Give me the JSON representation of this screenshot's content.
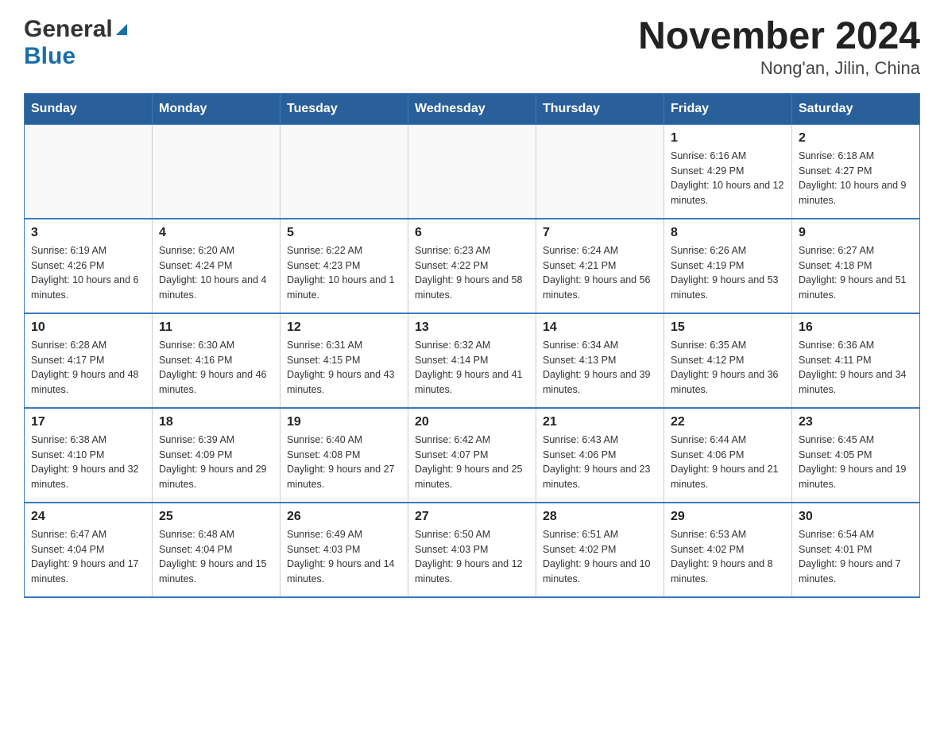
{
  "logo": {
    "general_text": "General",
    "blue_text": "Blue"
  },
  "title": "November 2024",
  "subtitle": "Nong'an, Jilin, China",
  "days_header": [
    "Sunday",
    "Monday",
    "Tuesday",
    "Wednesday",
    "Thursday",
    "Friday",
    "Saturday"
  ],
  "weeks": [
    {
      "days": [
        {
          "num": "",
          "info": ""
        },
        {
          "num": "",
          "info": ""
        },
        {
          "num": "",
          "info": ""
        },
        {
          "num": "",
          "info": ""
        },
        {
          "num": "",
          "info": ""
        },
        {
          "num": "1",
          "info": "Sunrise: 6:16 AM\nSunset: 4:29 PM\nDaylight: 10 hours and 12 minutes."
        },
        {
          "num": "2",
          "info": "Sunrise: 6:18 AM\nSunset: 4:27 PM\nDaylight: 10 hours and 9 minutes."
        }
      ]
    },
    {
      "days": [
        {
          "num": "3",
          "info": "Sunrise: 6:19 AM\nSunset: 4:26 PM\nDaylight: 10 hours and 6 minutes."
        },
        {
          "num": "4",
          "info": "Sunrise: 6:20 AM\nSunset: 4:24 PM\nDaylight: 10 hours and 4 minutes."
        },
        {
          "num": "5",
          "info": "Sunrise: 6:22 AM\nSunset: 4:23 PM\nDaylight: 10 hours and 1 minute."
        },
        {
          "num": "6",
          "info": "Sunrise: 6:23 AM\nSunset: 4:22 PM\nDaylight: 9 hours and 58 minutes."
        },
        {
          "num": "7",
          "info": "Sunrise: 6:24 AM\nSunset: 4:21 PM\nDaylight: 9 hours and 56 minutes."
        },
        {
          "num": "8",
          "info": "Sunrise: 6:26 AM\nSunset: 4:19 PM\nDaylight: 9 hours and 53 minutes."
        },
        {
          "num": "9",
          "info": "Sunrise: 6:27 AM\nSunset: 4:18 PM\nDaylight: 9 hours and 51 minutes."
        }
      ]
    },
    {
      "days": [
        {
          "num": "10",
          "info": "Sunrise: 6:28 AM\nSunset: 4:17 PM\nDaylight: 9 hours and 48 minutes."
        },
        {
          "num": "11",
          "info": "Sunrise: 6:30 AM\nSunset: 4:16 PM\nDaylight: 9 hours and 46 minutes."
        },
        {
          "num": "12",
          "info": "Sunrise: 6:31 AM\nSunset: 4:15 PM\nDaylight: 9 hours and 43 minutes."
        },
        {
          "num": "13",
          "info": "Sunrise: 6:32 AM\nSunset: 4:14 PM\nDaylight: 9 hours and 41 minutes."
        },
        {
          "num": "14",
          "info": "Sunrise: 6:34 AM\nSunset: 4:13 PM\nDaylight: 9 hours and 39 minutes."
        },
        {
          "num": "15",
          "info": "Sunrise: 6:35 AM\nSunset: 4:12 PM\nDaylight: 9 hours and 36 minutes."
        },
        {
          "num": "16",
          "info": "Sunrise: 6:36 AM\nSunset: 4:11 PM\nDaylight: 9 hours and 34 minutes."
        }
      ]
    },
    {
      "days": [
        {
          "num": "17",
          "info": "Sunrise: 6:38 AM\nSunset: 4:10 PM\nDaylight: 9 hours and 32 minutes."
        },
        {
          "num": "18",
          "info": "Sunrise: 6:39 AM\nSunset: 4:09 PM\nDaylight: 9 hours and 29 minutes."
        },
        {
          "num": "19",
          "info": "Sunrise: 6:40 AM\nSunset: 4:08 PM\nDaylight: 9 hours and 27 minutes."
        },
        {
          "num": "20",
          "info": "Sunrise: 6:42 AM\nSunset: 4:07 PM\nDaylight: 9 hours and 25 minutes."
        },
        {
          "num": "21",
          "info": "Sunrise: 6:43 AM\nSunset: 4:06 PM\nDaylight: 9 hours and 23 minutes."
        },
        {
          "num": "22",
          "info": "Sunrise: 6:44 AM\nSunset: 4:06 PM\nDaylight: 9 hours and 21 minutes."
        },
        {
          "num": "23",
          "info": "Sunrise: 6:45 AM\nSunset: 4:05 PM\nDaylight: 9 hours and 19 minutes."
        }
      ]
    },
    {
      "days": [
        {
          "num": "24",
          "info": "Sunrise: 6:47 AM\nSunset: 4:04 PM\nDaylight: 9 hours and 17 minutes."
        },
        {
          "num": "25",
          "info": "Sunrise: 6:48 AM\nSunset: 4:04 PM\nDaylight: 9 hours and 15 minutes."
        },
        {
          "num": "26",
          "info": "Sunrise: 6:49 AM\nSunset: 4:03 PM\nDaylight: 9 hours and 14 minutes."
        },
        {
          "num": "27",
          "info": "Sunrise: 6:50 AM\nSunset: 4:03 PM\nDaylight: 9 hours and 12 minutes."
        },
        {
          "num": "28",
          "info": "Sunrise: 6:51 AM\nSunset: 4:02 PM\nDaylight: 9 hours and 10 minutes."
        },
        {
          "num": "29",
          "info": "Sunrise: 6:53 AM\nSunset: 4:02 PM\nDaylight: 9 hours and 8 minutes."
        },
        {
          "num": "30",
          "info": "Sunrise: 6:54 AM\nSunset: 4:01 PM\nDaylight: 9 hours and 7 minutes."
        }
      ]
    }
  ]
}
